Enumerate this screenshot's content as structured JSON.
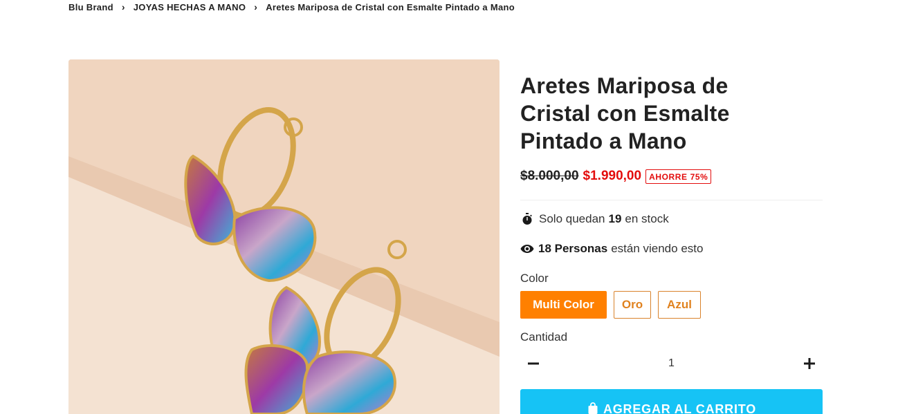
{
  "breadcrumb": {
    "items": [
      "Blu Brand",
      "JOYAS HECHAS A MANO",
      "Aretes Mariposa de Cristal con Esmalte Pintado a Mano"
    ],
    "separator": "›"
  },
  "product": {
    "title_lines": [
      "Aretes Mariposa de",
      "Cristal con Esmalte",
      "Pintado a Mano"
    ],
    "old_price": "$8.000,00",
    "new_price": "$1.990,00",
    "save_badge": "AHORRE 75%",
    "stock": {
      "prefix": "Solo quedan",
      "count": "19",
      "suffix": "en stock"
    },
    "viewers": {
      "count": "18 Personas",
      "suffix": "están viendo esto"
    },
    "color_label": "Color",
    "colors": [
      "Multi Color",
      "Oro",
      "Azul"
    ],
    "selected_color": "Multi Color",
    "quantity_label": "Cantidad",
    "quantity": "1",
    "add_to_cart": "AGREGAR AL CARRITO"
  },
  "theme": {
    "accent_orange": "#ff8000",
    "sale_red": "#e30c0c",
    "cart_blue": "#16c3f5"
  },
  "icons": {
    "stock": "stopwatch-icon",
    "viewers": "eye-icon",
    "minus": "minus-icon",
    "plus": "plus-icon",
    "cart": "shopping-bag-icon"
  }
}
